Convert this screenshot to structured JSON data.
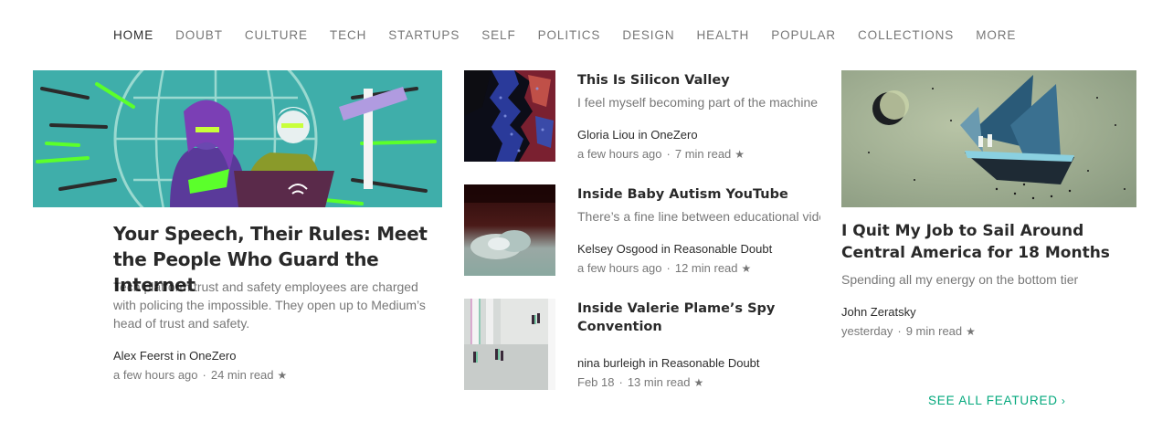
{
  "nav": {
    "items": [
      {
        "label": "HOME",
        "active": true
      },
      {
        "label": "DOUBT",
        "active": false
      },
      {
        "label": "CULTURE",
        "active": false
      },
      {
        "label": "TECH",
        "active": false
      },
      {
        "label": "STARTUPS",
        "active": false
      },
      {
        "label": "SELF",
        "active": false
      },
      {
        "label": "POLITICS",
        "active": false
      },
      {
        "label": "DESIGN",
        "active": false
      },
      {
        "label": "HEALTH",
        "active": false
      },
      {
        "label": "POPULAR",
        "active": false
      },
      {
        "label": "COLLECTIONS",
        "active": false
      },
      {
        "label": "MORE",
        "active": false
      }
    ]
  },
  "hero": {
    "title": "Your Speech, Their Rules: Meet the People Who Guard the Internet",
    "subtitle": "Tech platform trust and safety employees are charged with policing the impossible. They open up to Medium’s head of trust and safety.",
    "author": "Alex Feerst",
    "in_word": "in",
    "publication": "OneZero",
    "time": "a few hours ago",
    "read": "24 min read"
  },
  "middle": [
    {
      "title": "This Is Silicon Valley",
      "subtitle": "I feel myself becoming part of the machine",
      "author": "Gloria Liou",
      "in_word": "in",
      "publication": "OneZero",
      "time": "a few hours ago",
      "read": "7 min read"
    },
    {
      "title": "Inside Baby Autism YouTube",
      "subtitle": "There’s a fine line between educational videos",
      "author": "Kelsey Osgood",
      "in_word": "in",
      "publication": "Reasonable Doubt",
      "time": "a few hours ago",
      "read": "12 min read"
    },
    {
      "title": "Inside Valerie Plame’s Spy Convention",
      "subtitle": "",
      "author": "nina burleigh",
      "in_word": "in",
      "publication": "Reasonable Doubt",
      "time": "Feb 18",
      "read": "13 min read"
    }
  ],
  "right": {
    "title": "I Quit My Job to Sail Around Central America for 18 Months",
    "subtitle": "Spending all my energy on the bottom tier",
    "author": "John Zeratsky",
    "time": "yesterday",
    "read": "9 min read"
  },
  "separator_dot": "·",
  "star_glyph": "★",
  "see_all": {
    "label": "SEE ALL FEATURED",
    "chevron": "›"
  },
  "colors": {
    "accent": "#03a87c",
    "text": "#1a1a1a",
    "muted": "#757575"
  }
}
